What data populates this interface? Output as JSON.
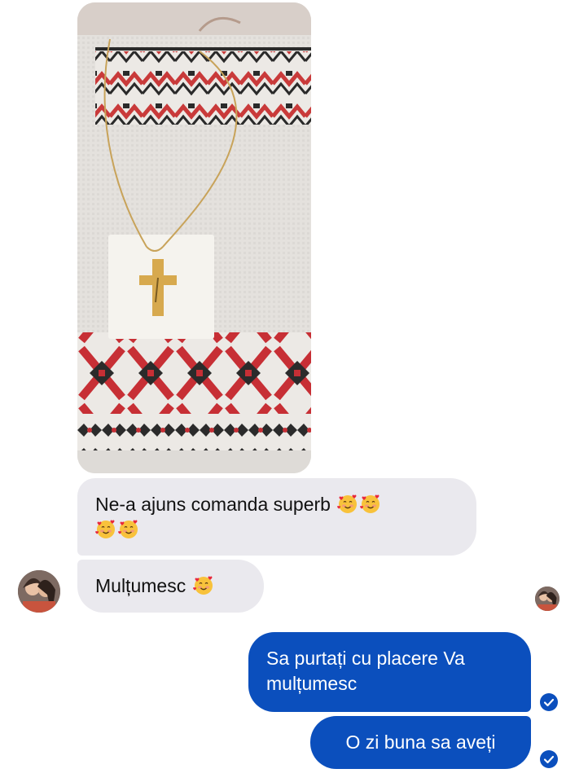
{
  "messages": [
    {
      "from": "contact",
      "text": "Ne-a ajuns comanda superb",
      "emoji": "smiling-face-with-hearts x4"
    },
    {
      "from": "contact",
      "text": "Mulțumesc",
      "emoji": "smiling-face-with-hearts"
    },
    {
      "from": "me",
      "text": "Sa purtați cu placere Va mulțumesc",
      "status": "sent"
    },
    {
      "from": "me",
      "text": "O zi buna sa aveți",
      "status": "sent"
    }
  ],
  "colors": {
    "incoming_bubble": "#eae9ee",
    "outgoing_bubble": "#0b4fbd",
    "outgoing_text": "#ffffff"
  },
  "icons": {
    "reaction_emoji": "smiling-face-with-hearts",
    "delivery": "check-circle-icon"
  }
}
